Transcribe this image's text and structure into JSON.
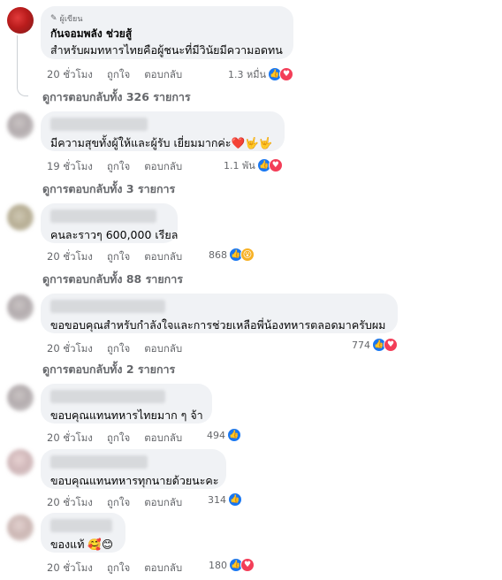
{
  "comments": [
    {
      "author_badge": "ผู้เขียน",
      "author": "กันจอมพลัง ช่วยสู้",
      "text": "สำหรับผมทหารไทยคือผู้ชนะที่มีวินัยมีความอดทน",
      "time": "20 ชั่วโมง",
      "like": "ถูกใจ",
      "reply": "ตอบกลับ",
      "reactions": "1.3 หมื่น",
      "reaction_types": [
        "like-icon",
        "love-icon"
      ],
      "replies_link": "ดูการตอบกลับทั้ง 326 รายการ"
    },
    {
      "text": "มีความสุขทั้งผู้ให้และผู้รับ เยี่ยมมากค่ะ❤️🤟🤟",
      "time": "19 ชั่วโมง",
      "like": "ถูกใจ",
      "reply": "ตอบกลับ",
      "reactions": "1.1 พัน",
      "reaction_types": [
        "like-icon",
        "love-icon"
      ],
      "replies_link": "ดูการตอบกลับทั้ง 3 รายการ"
    },
    {
      "text": "คนละราวๆ 600,000 เรียล",
      "time": "20 ชั่วโมง",
      "like": "ถูกใจ",
      "reply": "ตอบกลับ",
      "reactions": "868",
      "reaction_types": [
        "like-icon",
        "wow-icon"
      ],
      "replies_link": "ดูการตอบกลับทั้ง 88 รายการ"
    },
    {
      "text": "ขอขอบคุณสำหรับกำลังใจและการช่วยเหลือพี่น้องทหารตลอดมาครับผม",
      "time": "20 ชั่วโมง",
      "like": "ถูกใจ",
      "reply": "ตอบกลับ",
      "reactions": "774",
      "reaction_types": [
        "like-icon",
        "love-icon"
      ],
      "replies_link": "ดูการตอบกลับทั้ง 2 รายการ"
    },
    {
      "text": "ขอบคุณแทนทหารไทยมาก ๆ จ้า",
      "time": "20 ชั่วโมง",
      "like": "ถูกใจ",
      "reply": "ตอบกลับ",
      "reactions": "494",
      "reaction_types": [
        "like-icon"
      ]
    },
    {
      "text": "ขอบคุณแทนทหารทุกนายด้วยนะคะ",
      "time": "20 ชั่วโมง",
      "like": "ถูกใจ",
      "reply": "ตอบกลับ",
      "reactions": "314",
      "reaction_types": [
        "like-icon"
      ]
    },
    {
      "text": "ของแท้ 🥰😊",
      "time": "20 ชั่วโมง",
      "like": "ถูกใจ",
      "reply": "ตอบกลับ",
      "reactions": "180",
      "reaction_types": [
        "like-icon",
        "love-icon"
      ]
    }
  ],
  "colors": {
    "bubble": "#f0f2f5",
    "meta": "#65676b",
    "like": "#1877f2",
    "love": "#f33e58",
    "wow": "#f7b125"
  }
}
